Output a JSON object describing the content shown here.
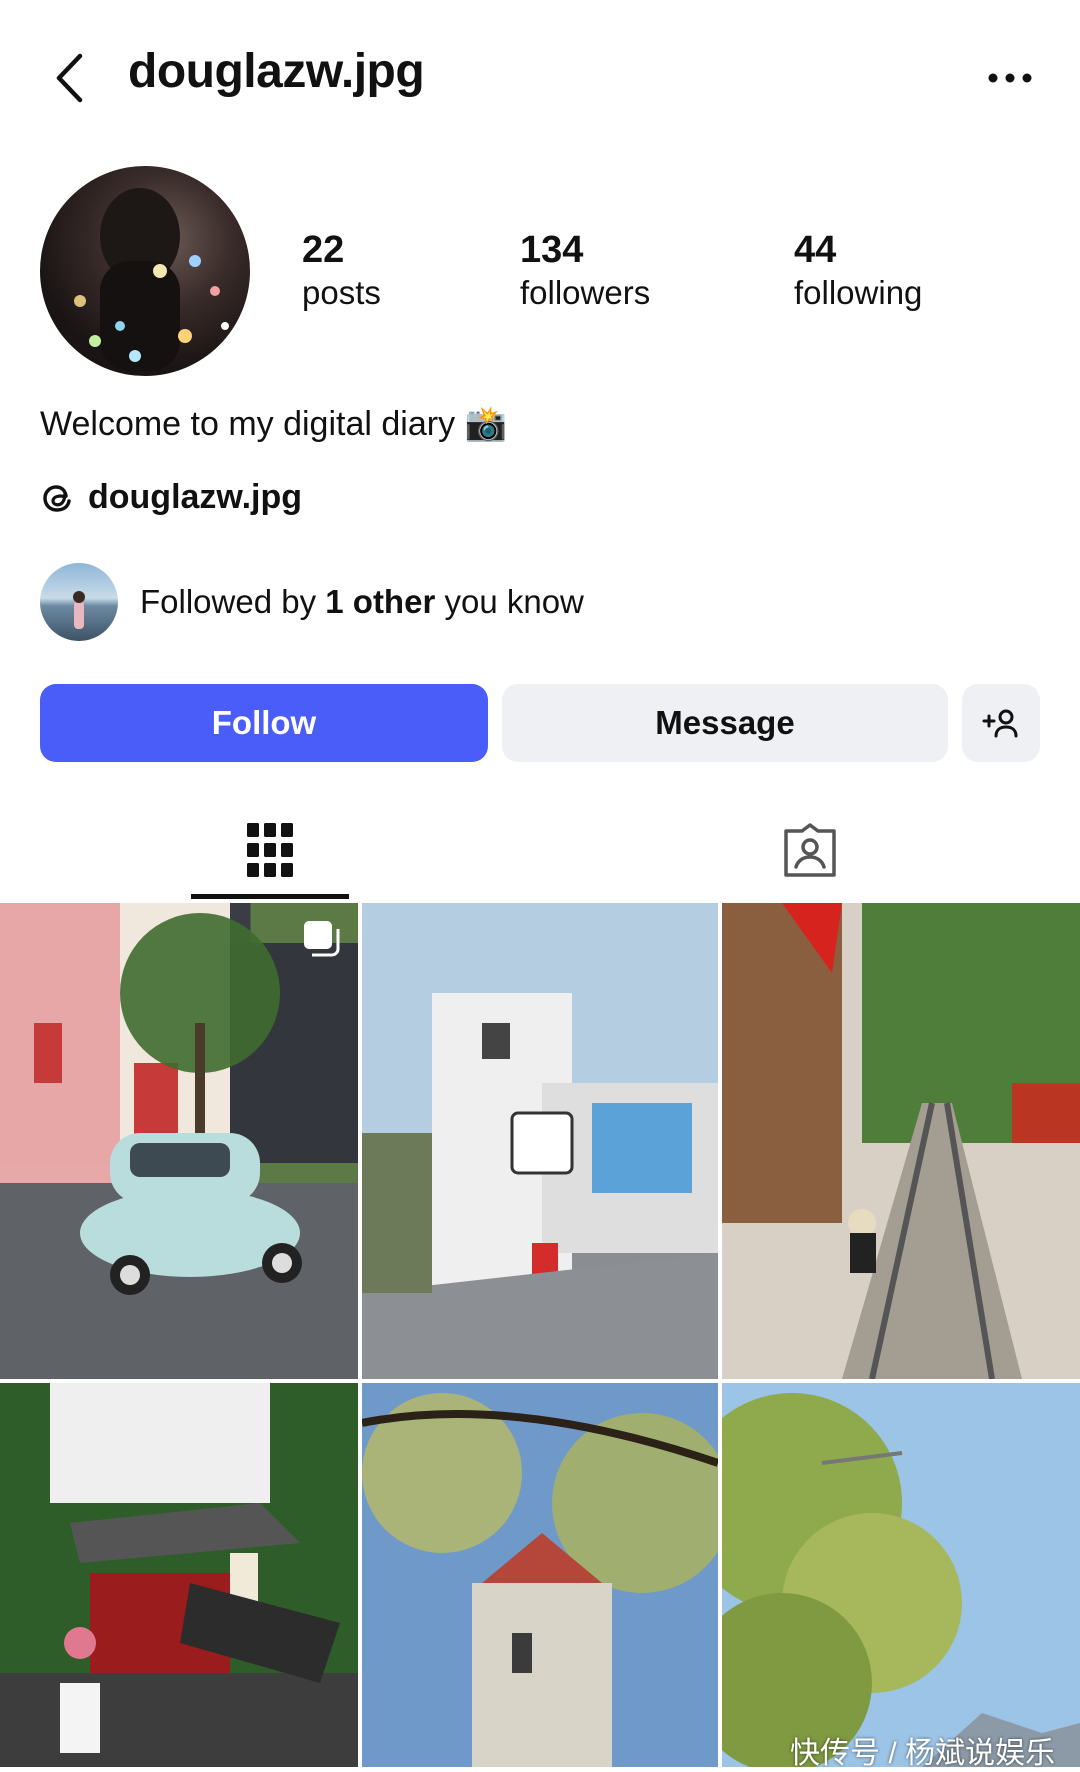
{
  "header": {
    "username": "douglazw.jpg",
    "back_icon": "chevron-left-icon",
    "more_icon": "more-horizontal-icon"
  },
  "stats": [
    {
      "value": "22",
      "label": "posts"
    },
    {
      "value": "134",
      "label": "followers"
    },
    {
      "value": "44",
      "label": "following"
    }
  ],
  "bio": {
    "text": "Welcome to my digital diary 📸",
    "threads_icon": "threads-icon",
    "threads_handle": "douglazw.jpg"
  },
  "followed_by": {
    "prefix": "Followed by ",
    "bold": "1 other",
    "suffix": " you know"
  },
  "actions": {
    "follow": "Follow",
    "message": "Message",
    "add_user_icon": "add-user-icon"
  },
  "tabs": {
    "grid_icon": "grid-icon",
    "tagged_icon": "tagged-icon"
  },
  "watermark": "快传号 / 杨斌说娱乐",
  "colors": {
    "follow_button": "#4a5df9",
    "secondary_button": "#eef0f3"
  }
}
